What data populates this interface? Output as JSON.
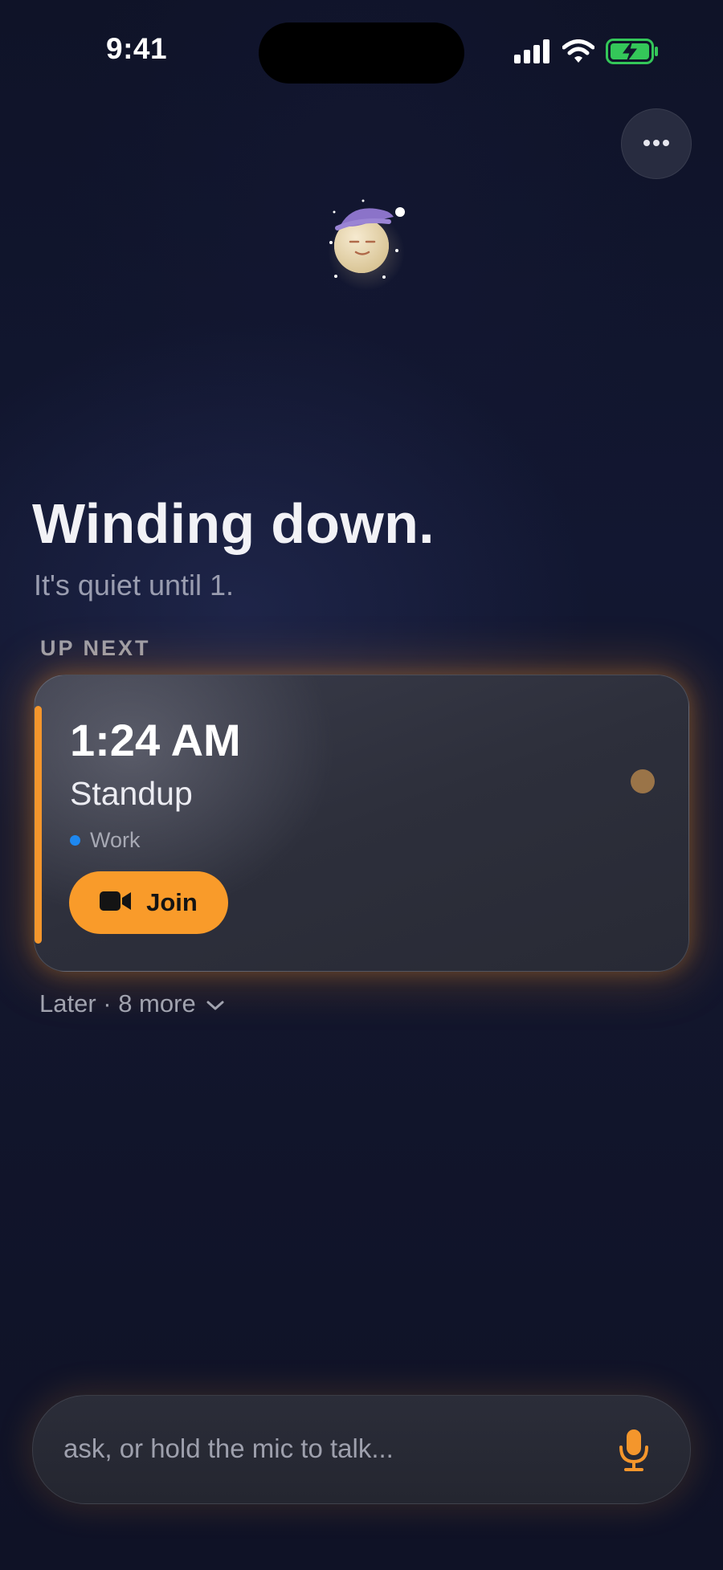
{
  "status_bar": {
    "time": "9:41",
    "icons": [
      "cellular-signal-icon",
      "wifi-icon",
      "battery-charging-icon"
    ],
    "battery_color": "#34c759"
  },
  "header": {
    "more_icon": "ellipsis-icon",
    "mascot": "sleepy-moon-icon"
  },
  "main": {
    "headline": "Winding down.",
    "subtitle": "It's quiet until 1.",
    "up_next_label": "UP NEXT",
    "event": {
      "time": "1:24 AM",
      "title": "Standup",
      "category": "Work",
      "category_color": "#1e88f0",
      "join_label": "Join",
      "join_icon": "video-camera-icon",
      "accent_color": "#f4962c"
    },
    "later_text": "Later · 8 more",
    "later_icon": "chevron-down-icon"
  },
  "composer": {
    "placeholder": "ask, or hold the mic to talk...",
    "mic_icon": "microphone-icon",
    "mic_color": "#f4962c"
  }
}
